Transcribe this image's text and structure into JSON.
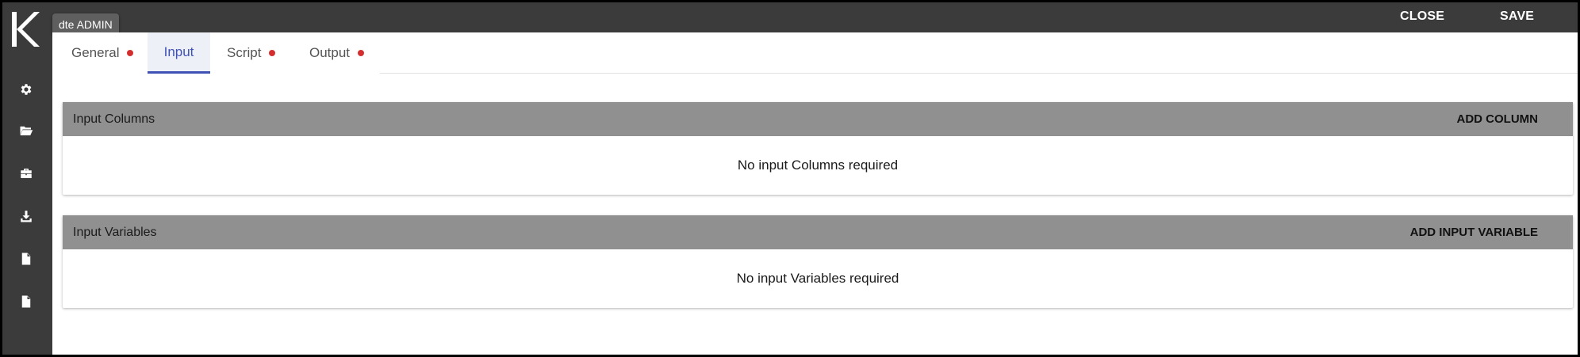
{
  "sidebar": {
    "logo_letter": "K",
    "items": [
      {
        "icon": "gear-icon"
      },
      {
        "icon": "folder-open-icon"
      },
      {
        "icon": "briefcase-icon"
      },
      {
        "icon": "download-icon"
      },
      {
        "icon": "document-icon"
      },
      {
        "icon": "document-icon"
      }
    ]
  },
  "tooltip": {
    "text": "dte ADMIN"
  },
  "topbar": {
    "close_label": "CLOSE",
    "save_label": "SAVE"
  },
  "tabs": [
    {
      "label": "General",
      "has_dot": true
    },
    {
      "label": "Input",
      "has_dot": false,
      "active": true
    },
    {
      "label": "Script",
      "has_dot": true
    },
    {
      "label": "Output",
      "has_dot": true
    }
  ],
  "panels": [
    {
      "title": "Input Columns",
      "action": "ADD COLUMN",
      "empty_text": "No input Columns required"
    },
    {
      "title": "Input Variables",
      "action": "ADD INPUT VARIABLE",
      "empty_text": "No input Variables required"
    }
  ],
  "colors": {
    "sidebar_bg": "#3b3b3b",
    "accent": "#3f51b5",
    "dot": "#d32f2f",
    "panel_header": "#909090"
  }
}
